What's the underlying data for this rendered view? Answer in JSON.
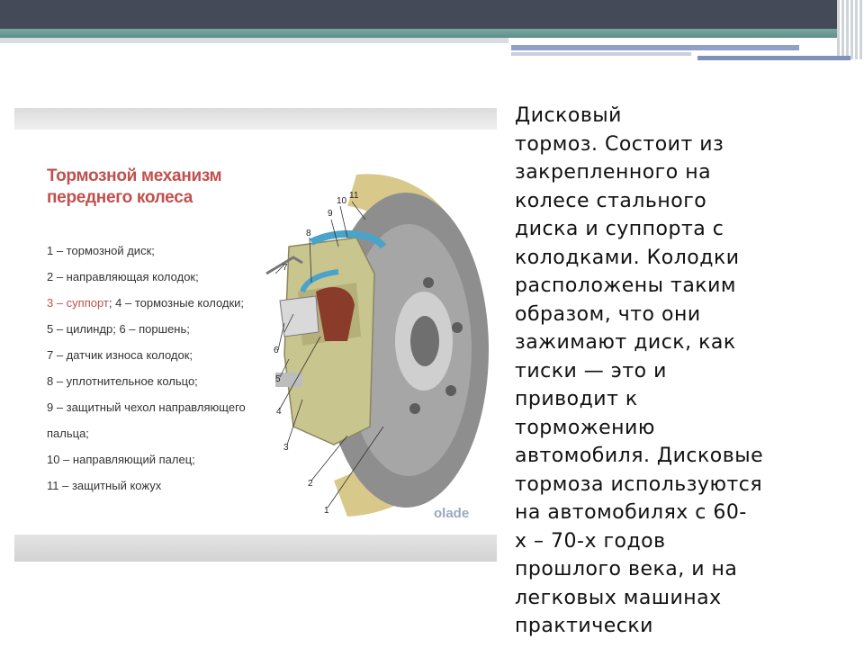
{
  "slide": {
    "text": "Дисковый\nтормоз. Состоит из\nзакрепленного на\nколесе стального\nдиска и суппорта с\nколодками. Колодки\nрасположены таким\nобразом, что они\nзажимают диск, как\nтиски — это и\nприводит к\nторможению\nавтомобиля. Дисковые\nтормоза используются\nна автомобилях с 60-\nх – 70-х годов\nпрошлого века, и на\nлегковых машинах\nпрактически"
  },
  "figure": {
    "title_line1": "Тормозной механизм",
    "title_line2": "переднего колеса",
    "legend": [
      "1 – тормозной диск;",
      "2 – направляющая колодок;",
      "3 – суппорт; 4 – тормозные колодки;",
      "5 – цилиндр; 6 – поршень;",
      "7 – датчик износа колодок;",
      "8 – уплотнительное кольцо;",
      "9 – защитный чехол направляющего",
      "пальца;",
      "10 – направляющий палец;",
      "11 – защитный кожух"
    ],
    "legend_highlight": "3 – суппорт",
    "legend_rest_3": "; 4 – тормозные колодки;",
    "callouts": [
      "1",
      "2",
      "3",
      "4",
      "5",
      "6",
      "7",
      "8",
      "9",
      "10",
      "11"
    ],
    "watermark": "olade",
    "colors": {
      "title": "#c0504d",
      "caliper": "#c9c58f",
      "disc": "#8c8c8c",
      "accent_blue": "#4aa3c9"
    }
  }
}
